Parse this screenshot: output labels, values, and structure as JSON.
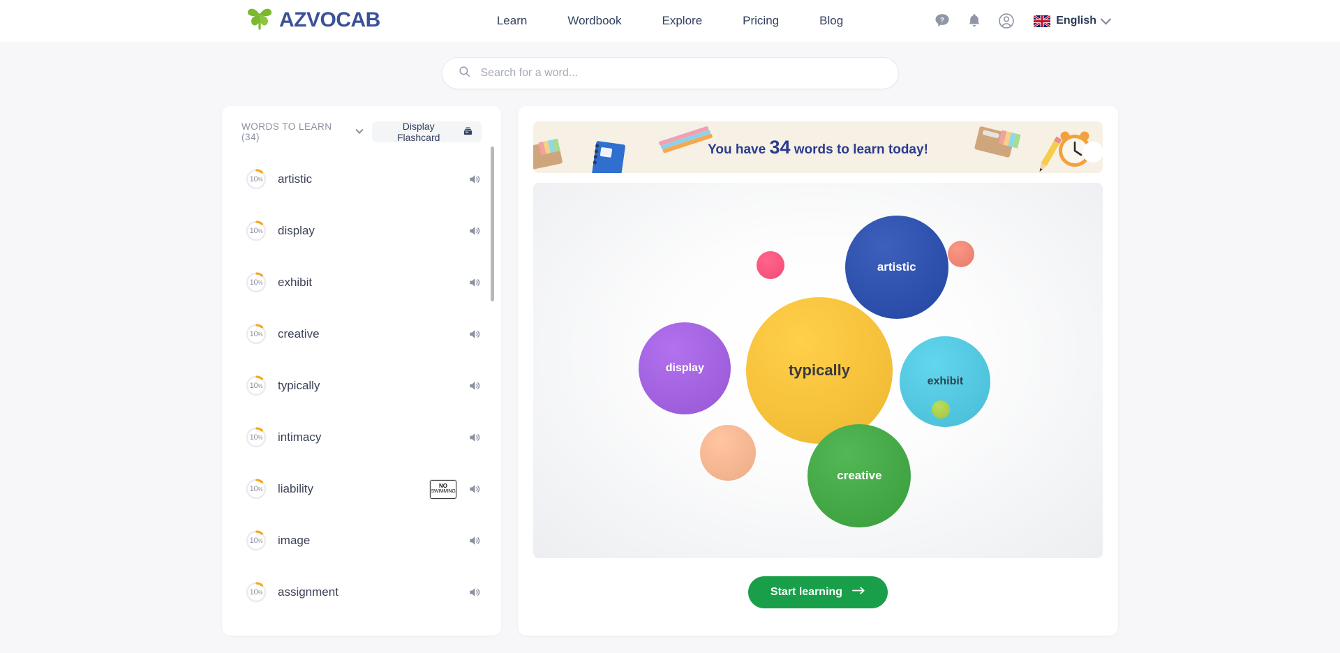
{
  "header": {
    "logo_text": "AZVOCAB",
    "logo_icon": "plant-leaf-icon",
    "nav": [
      {
        "label": "Learn",
        "active": true
      },
      {
        "label": "Wordbook",
        "active": false
      },
      {
        "label": "Explore",
        "active": false
      },
      {
        "label": "Pricing",
        "active": false
      },
      {
        "label": "Blog",
        "active": false
      }
    ],
    "icons": [
      "help-icon",
      "bell-icon",
      "user-account-icon"
    ],
    "language": {
      "label": "English",
      "flag": "uk-flag-icon",
      "chevron": "chevron-down-icon"
    }
  },
  "search": {
    "placeholder": "Search for a word...",
    "value": "",
    "icon": "search-icon"
  },
  "sidebar": {
    "title": "WORDS TO LEARN (34)",
    "title_chevron": "chevron-down-icon",
    "flashcard_button": {
      "label": "Display Flashcard",
      "icon": "flashcard-icon"
    },
    "words": [
      {
        "progress": "10",
        "unit": "%",
        "label": "artistic",
        "speaker": "speaker-icon",
        "thumb": null
      },
      {
        "progress": "10",
        "unit": "%",
        "label": "display",
        "speaker": "speaker-icon",
        "thumb": null
      },
      {
        "progress": "10",
        "unit": "%",
        "label": "exhibit",
        "speaker": "speaker-icon",
        "thumb": null
      },
      {
        "progress": "10",
        "unit": "%",
        "label": "creative",
        "speaker": "speaker-icon",
        "thumb": null
      },
      {
        "progress": "10",
        "unit": "%",
        "label": "typically",
        "speaker": "speaker-icon",
        "thumb": null
      },
      {
        "progress": "10",
        "unit": "%",
        "label": "intimacy",
        "speaker": "speaker-icon",
        "thumb": null
      },
      {
        "progress": "10",
        "unit": "%",
        "label": "liability",
        "speaker": "speaker-icon",
        "thumb": {
          "line1": "NO",
          "line2": "SWIMMING"
        }
      },
      {
        "progress": "10",
        "unit": "%",
        "label": "image",
        "speaker": "speaker-icon",
        "thumb": null
      },
      {
        "progress": "10",
        "unit": "%",
        "label": "assignment",
        "speaker": "speaker-icon",
        "thumb": null
      }
    ]
  },
  "main": {
    "banner": {
      "prefix": "You have ",
      "count": "34",
      "suffix": " words to learn today!",
      "bg_color": "#f7f0e4",
      "text_color": "#2b3c8f"
    },
    "cta": {
      "label": "Start learning",
      "icon": "arrow-right-icon",
      "color": "#199f49"
    }
  },
  "chart_data": {
    "type": "bubble",
    "title": "",
    "bubbles": [
      {
        "label": "typically",
        "x": 50,
        "y": 50,
        "r": 105,
        "color": "#f7c23c",
        "text_color": "#3a3a3a",
        "font_size": 22
      },
      {
        "label": "artistic",
        "x": 63.5,
        "y": 22.5,
        "r": 74,
        "color": "#2f52ae",
        "text_color": "#ffffff",
        "font_size": 17
      },
      {
        "label": "creative",
        "x": 57,
        "y": 78,
        "r": 74,
        "color": "#45a948",
        "text_color": "#ffffff",
        "font_size": 17
      },
      {
        "label": "exhibit",
        "x": 72,
        "y": 53,
        "r": 65,
        "color": "#54c8e0",
        "text_color": "#33424f",
        "font_size": 16
      },
      {
        "label": "display",
        "x": 26.5,
        "y": 49.5,
        "r": 66,
        "color": "#a463e0",
        "text_color": "#ffffff",
        "font_size": 16
      },
      {
        "label": "",
        "x": 34,
        "y": 72,
        "r": 40,
        "color": "#f6b793",
        "text_color": "#ffffff",
        "font_size": 0
      },
      {
        "label": "",
        "x": 41.5,
        "y": 22,
        "r": 20,
        "color": "#f9577f",
        "text_color": "#ffffff",
        "font_size": 0
      },
      {
        "label": "",
        "x": 74.8,
        "y": 19,
        "r": 19,
        "color": "#f08877",
        "text_color": "#ffffff",
        "font_size": 0
      },
      {
        "label": "",
        "x": 71.2,
        "y": 60.5,
        "r": 13,
        "color": "#aed04f",
        "text_color": "#ffffff",
        "font_size": 0
      }
    ],
    "xlabel": "",
    "ylabel": "",
    "legend": "none",
    "grid": false
  }
}
